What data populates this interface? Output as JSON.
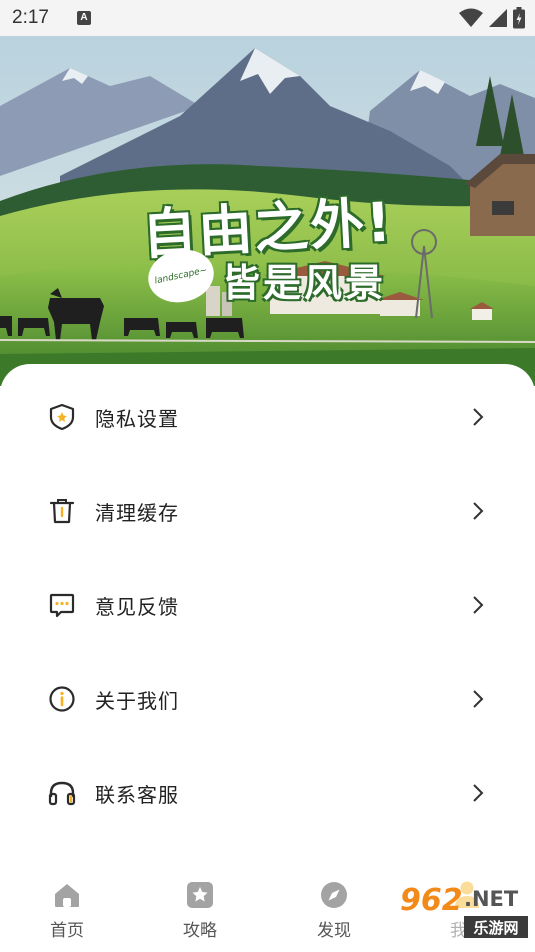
{
  "status_bar": {
    "time": "2:17",
    "notification_icon": "a-box-icon",
    "icons": [
      "wifi-icon",
      "signal-icon",
      "battery-icon"
    ]
  },
  "banner": {
    "slogan_line1": "自由之外!",
    "slogan_bubble": "landscape~",
    "slogan_line2": "皆是风景"
  },
  "menu": {
    "items": [
      {
        "label": "隐私设置",
        "icon": "shield-icon"
      },
      {
        "label": "清理缓存",
        "icon": "trash-icon"
      },
      {
        "label": "意见反馈",
        "icon": "message-icon"
      },
      {
        "label": "关于我们",
        "icon": "info-icon"
      },
      {
        "label": "联系客服",
        "icon": "headset-icon"
      }
    ]
  },
  "tabbar": {
    "tabs": [
      {
        "label": "首页",
        "icon": "home-icon"
      },
      {
        "label": "攻略",
        "icon": "star-icon"
      },
      {
        "label": "发现",
        "icon": "compass-icon"
      },
      {
        "label": "我的",
        "icon": "user-icon",
        "active": true
      }
    ]
  },
  "colors": {
    "icon_dark": "#2b2b2b",
    "accent_yellow": "#f5b321",
    "tab_gray": "#9a9a9a",
    "grass_green": "#6aa636",
    "text_dark": "#222222"
  },
  "watermark": {
    "brand": "962",
    "domain_suffix": ".NET",
    "caption": "乐游网"
  }
}
